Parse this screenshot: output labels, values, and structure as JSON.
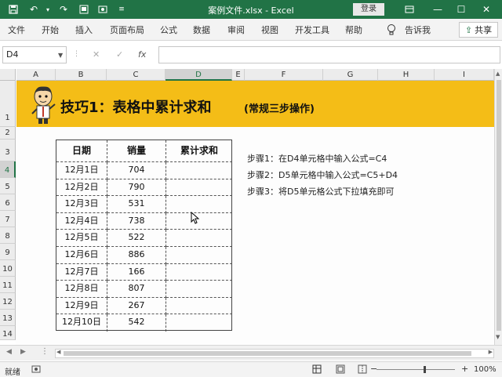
{
  "titlebar": {
    "document_title": "案例文件.xlsx  -  Excel",
    "login_label": "登录"
  },
  "ribbon": {
    "tabs": [
      "文件",
      "开始",
      "插入",
      "页面布局",
      "公式",
      "数据",
      "审阅",
      "视图",
      "开发工具",
      "帮助"
    ],
    "tell_me": "告诉我",
    "share_label": "共享"
  },
  "formula_bar": {
    "name_box": "D4",
    "formula": ""
  },
  "grid": {
    "columns": [
      "A",
      "B",
      "C",
      "D",
      "E",
      "F",
      "G",
      "H",
      "I"
    ],
    "rows": [
      "1",
      "2",
      "3",
      "4",
      "5",
      "6",
      "7",
      "8",
      "9",
      "10",
      "11",
      "12",
      "13",
      "14"
    ],
    "selected_column": "D",
    "selected_row": "4"
  },
  "banner": {
    "title": "技巧1：表格中累计求和",
    "subtitle": "(常规三步操作)",
    "color": "#f4bd17"
  },
  "table": {
    "headers": [
      "日期",
      "销量",
      "累计求和"
    ],
    "rows": [
      [
        "12月1日",
        "704",
        ""
      ],
      [
        "12月2日",
        "790",
        ""
      ],
      [
        "12月3日",
        "531",
        ""
      ],
      [
        "12月4日",
        "738",
        ""
      ],
      [
        "12月5日",
        "522",
        ""
      ],
      [
        "12月6日",
        "886",
        ""
      ],
      [
        "12月7日",
        "166",
        ""
      ],
      [
        "12月8日",
        "807",
        ""
      ],
      [
        "12月9日",
        "267",
        ""
      ],
      [
        "12月10日",
        "542",
        ""
      ]
    ]
  },
  "steps": [
    "步骤1：在D4单元格中输入公式=C4",
    "步骤2：D5单元格中输入公式=C5+D4",
    "步骤3：将D5单元格公式下拉填充即可"
  ],
  "statusbar": {
    "status": "就绪",
    "zoom": "100%"
  },
  "colors": {
    "accent": "#217346",
    "banner": "#f4bd17"
  }
}
